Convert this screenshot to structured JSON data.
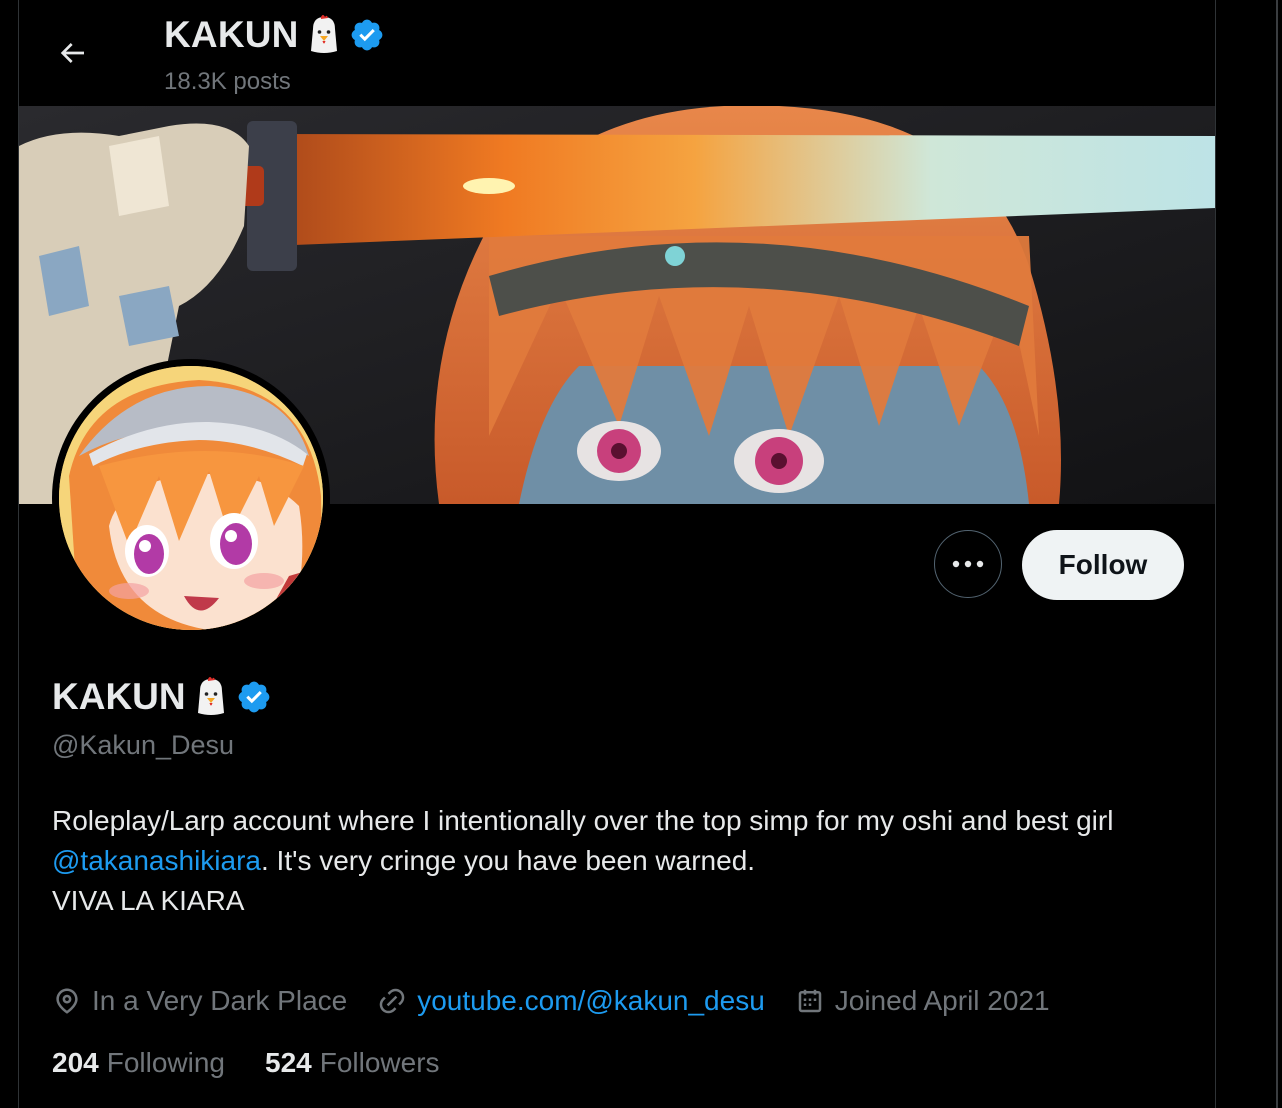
{
  "header": {
    "name": "KAKUN",
    "posts": "18.3K posts"
  },
  "profile": {
    "display_name": "KAKUN",
    "handle": "@Kakun_Desu",
    "bio_line1": "Roleplay/Larp account where I intentionally over the top simp for my oshi and best girl",
    "bio_mention": "@takanashikiara",
    "bio_line2_rest": ". It's very cringe you have been warned.",
    "bio_line3": "VIVA LA KIARA",
    "location": "In a Very Dark Place",
    "website": "youtube.com/@kakun_desu",
    "joined": "Joined April 2021"
  },
  "stats": {
    "following_count": "204",
    "following_label": "Following",
    "followers_count": "524",
    "followers_label": "Followers"
  },
  "actions": {
    "follow_label": "Follow"
  },
  "icons": {
    "back": "arrow-left-icon",
    "verified": "verified-badge-icon",
    "more": "more-dots-icon",
    "location": "location-pin-icon",
    "link": "link-icon",
    "calendar": "calendar-icon",
    "chick": "chick-emoji-icon"
  },
  "colors": {
    "accent": "#1d9bf0",
    "muted": "#71767b",
    "text": "#e7e9ea",
    "background": "#000000"
  }
}
